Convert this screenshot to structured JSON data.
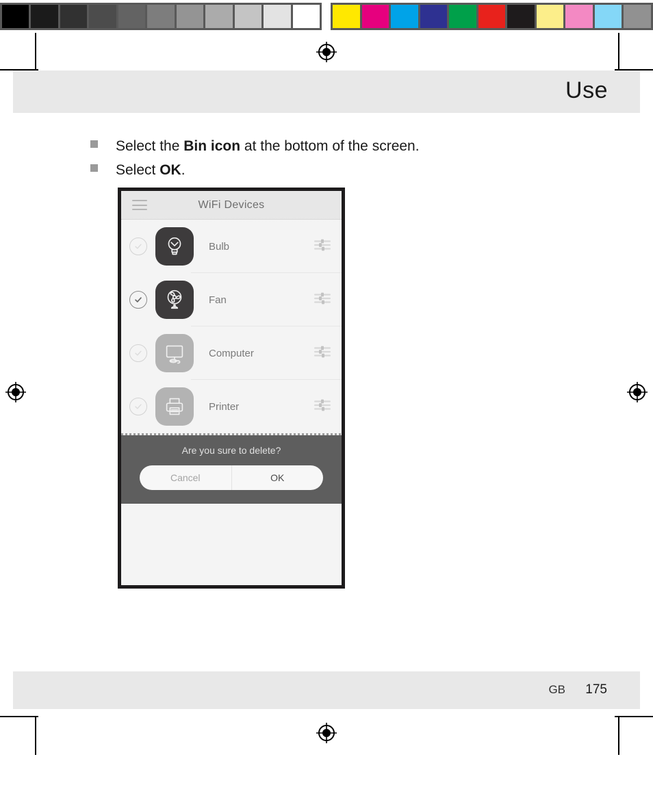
{
  "calibration": {
    "gray_patches": [
      "#000000",
      "#1b1b1b",
      "#313131",
      "#4c4c4c",
      "#636363",
      "#7d7d7d",
      "#949494",
      "#ababab",
      "#c4c4c4",
      "#e3e3e3",
      "#ffffff"
    ],
    "color_patches": [
      "#ffe800",
      "#e6007e",
      "#00a3e8",
      "#2e3191",
      "#00a04a",
      "#e8221c",
      "#1e1b1c",
      "#fcee8a",
      "#f389c3",
      "#84d7f7",
      "#919191"
    ]
  },
  "header": {
    "title": "Use"
  },
  "footer": {
    "language": "GB",
    "page_number": "175"
  },
  "instructions": [
    {
      "prefix": "Select the ",
      "bold": "Bin icon",
      "suffix": " at the bottom of the screen."
    },
    {
      "prefix": "Select ",
      "bold": "OK",
      "suffix": "."
    }
  ],
  "phone": {
    "app": {
      "menu_icon": "hamburger-menu-icon",
      "title": "WiFi Devices"
    },
    "devices": [
      {
        "name": "Bulb",
        "icon": "bulb-icon",
        "checked": false,
        "active": true,
        "settings_icon": "sliders-icon"
      },
      {
        "name": "Fan",
        "icon": "fan-icon",
        "checked": true,
        "active": true,
        "settings_icon": "sliders-icon"
      },
      {
        "name": "Computer",
        "icon": "computer-icon",
        "checked": false,
        "active": false,
        "settings_icon": "sliders-icon"
      },
      {
        "name": "Printer",
        "icon": "printer-icon",
        "checked": false,
        "active": false,
        "settings_icon": "sliders-icon"
      }
    ],
    "confirm_dialog": {
      "message": "Are you sure to delete?",
      "cancel_label": "Cancel",
      "ok_label": "OK"
    }
  }
}
